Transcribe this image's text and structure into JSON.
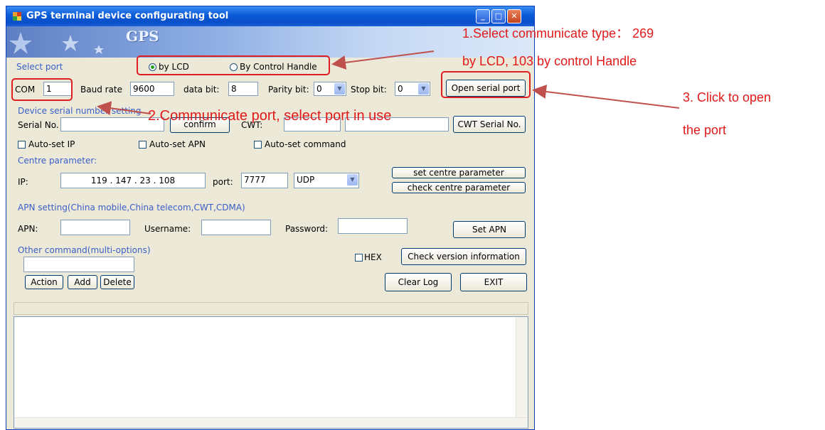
{
  "window": {
    "title": "GPS terminal device configurating tool",
    "banner_text": "GPS"
  },
  "select_port": {
    "heading": "Select port",
    "options": [
      "by LCD",
      "By Control Handle"
    ],
    "selected": "by LCD"
  },
  "serial": {
    "com_label": "COM",
    "com_value": "1",
    "baud_label": "Baud rate",
    "baud_value": "9600",
    "databit_label": "data bit:",
    "databit_value": "8",
    "parity_label": "Parity bit:",
    "parity_value": "0",
    "stopbit_label": "Stop bit:",
    "stopbit_value": "0",
    "open_button": "Open serial port"
  },
  "device_serial": {
    "heading": "Device serial number setting",
    "serial_label": "Serial No.",
    "serial_value": "",
    "confirm_button": "confirm",
    "cwt_label": "CWT:",
    "cwt_button": "CWT Serial No."
  },
  "auto": {
    "ip": "Auto-set IP",
    "apn": "Auto-set APN",
    "command": "Auto-set command"
  },
  "centre": {
    "heading": "Centre parameter:",
    "ip_label": "IP:",
    "ip_value": "119 . 147 . 23 . 108",
    "port_label": "port:",
    "port_value": "7777",
    "protocol": "UDP",
    "set_button": "set centre parameter",
    "check_button": "check centre parameter"
  },
  "apn": {
    "heading": "APN setting(China mobile,China telecom,CWT,CDMA)",
    "apn_label": "APN:",
    "username_label": "Username:",
    "password_label": "Password:",
    "set_button": "Set APN"
  },
  "other": {
    "heading": "Other command(multi-options)",
    "hex_label": "HEX",
    "version_button": "Check version information",
    "action_button": "Action",
    "add_button": "Add",
    "delete_button": "Delete",
    "clear_button": "Clear Log",
    "exit_button": "EXIT"
  },
  "annotations": {
    "a1_line1": "1.Select communicate type：  269",
    "a1_line2": "by LCD, 103 by control Handle",
    "a2": "2.Communicate port, select port in use",
    "a3_line1": "3.  Click  to  open",
    "a3_line2": "the port"
  },
  "colors": {
    "annotation": "#e01a1a",
    "titlebar": "#0b5ad8",
    "section_heading": "#3a5fc8"
  }
}
